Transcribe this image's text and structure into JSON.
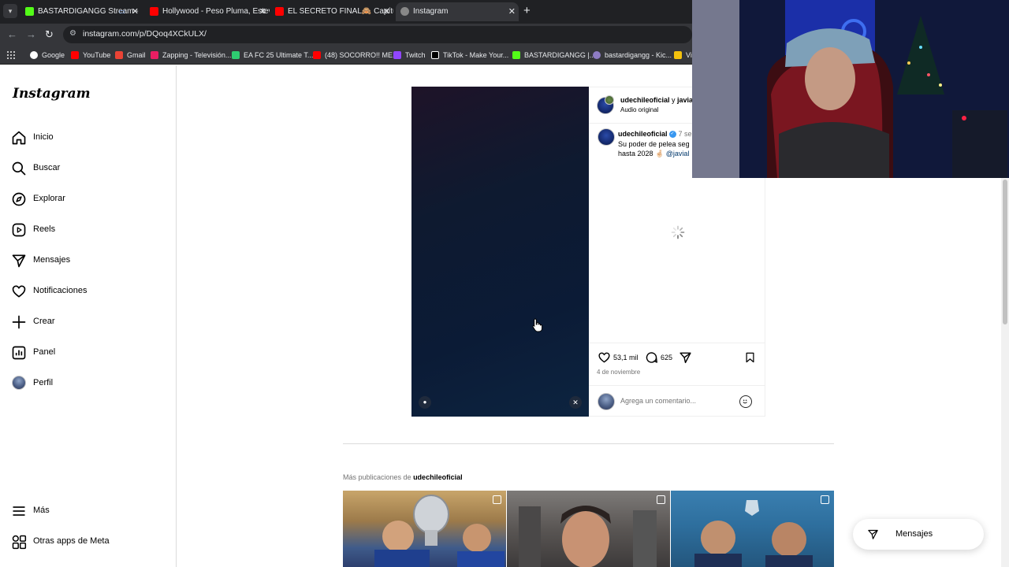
{
  "browser": {
    "tabs": [
      {
        "title": "BASTARDIGANGG Stream -",
        "favicon_color": "#53fc18"
      },
      {
        "title": "Hollywood - Peso Pluma, Esteva",
        "favicon_color": "#ff0000"
      },
      {
        "title": "EL SECRETO FINAL🙈 Capítulo",
        "favicon_color": "#ff0000"
      },
      {
        "title": "Instagram",
        "favicon_color": "#888888"
      }
    ],
    "url": "instagram.com/p/DQoq4XCkULX/",
    "bookmarks": [
      {
        "label": "Google",
        "color": "#ffffff"
      },
      {
        "label": "YouTube",
        "color": "#ff0000"
      },
      {
        "label": "Gmail",
        "color": "#ea4335"
      },
      {
        "label": "Zapping - Televisión...",
        "color": "#e91e63"
      },
      {
        "label": "EA FC 25 Ultimate T...",
        "color": "#2ecc71"
      },
      {
        "label": "(48) SOCORRO!! ME...",
        "color": "#ff0000"
      },
      {
        "label": "Twitch",
        "color": "#9146ff"
      },
      {
        "label": "TikTok - Make Your...",
        "color": "#ffffff"
      },
      {
        "label": "BASTARDIGANGG |...",
        "color": "#53fc18"
      },
      {
        "label": "bastardigangg - Kic...",
        "color": "#8e7cc3"
      },
      {
        "label": "Vi",
        "color": "#f4c20d"
      }
    ]
  },
  "sidebar": {
    "logo": "Instagram",
    "items": [
      {
        "label": "Inicio",
        "icon": "home-icon"
      },
      {
        "label": "Buscar",
        "icon": "search-icon"
      },
      {
        "label": "Explorar",
        "icon": "compass-icon"
      },
      {
        "label": "Reels",
        "icon": "reels-icon"
      },
      {
        "label": "Mensajes",
        "icon": "send-icon"
      },
      {
        "label": "Notificaciones",
        "icon": "heart-icon"
      },
      {
        "label": "Crear",
        "icon": "plus-icon"
      },
      {
        "label": "Panel",
        "icon": "chart-icon"
      },
      {
        "label": "Perfil",
        "icon": "avatar-icon"
      }
    ],
    "bottom": [
      {
        "label": "Más",
        "icon": "menu-icon"
      },
      {
        "label": "Otras apps de Meta",
        "icon": "apps-icon"
      }
    ]
  },
  "post": {
    "header_user": "udechileoficial",
    "header_connector": " y ",
    "header_collab": "javia",
    "audio": "Audio original",
    "caption_user": "udechileoficial",
    "caption_time": "7 se",
    "caption_text": "Su poder de pelea seg",
    "caption_text2": "hasta 2028 🤞🏻 ",
    "caption_mention": "@javial",
    "likes": "53,1 mil",
    "comments": "625",
    "date": "4 de noviembre",
    "comment_placeholder": "Agrega un comentario..."
  },
  "more": {
    "prefix": "Más publicaciones de ",
    "user": "udechileoficial"
  },
  "messages_pill": {
    "label": "Mensajes"
  }
}
